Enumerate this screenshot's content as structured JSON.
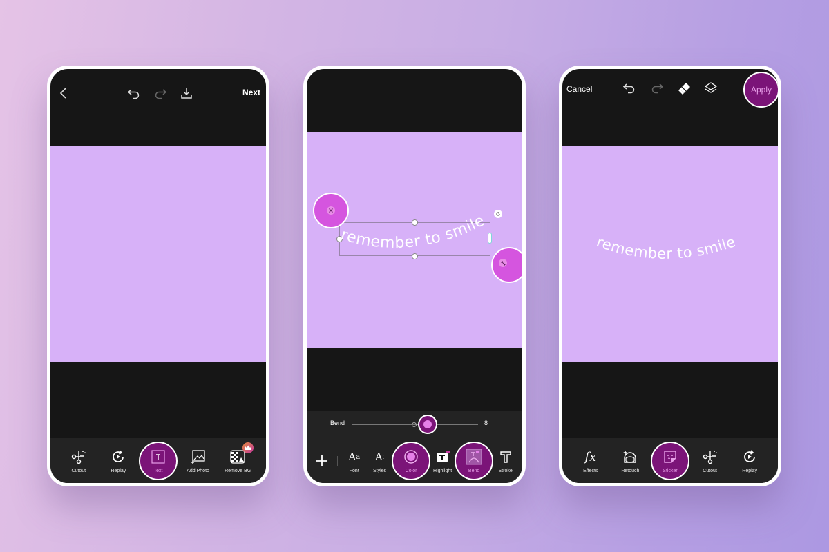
{
  "colors": {
    "canvas": "#d7b1f8",
    "screen": "#161616",
    "toolbar": "#232323",
    "accent": "#7b1478",
    "highlight": "#d555df",
    "accent_text": "#e79de8"
  },
  "phone1": {
    "topbar": {
      "back_icon": "chevron-left-icon",
      "undo_icon": "undo-icon",
      "redo_icon": "redo-icon",
      "download_icon": "download-icon",
      "next_label": "Next"
    },
    "toolbar": [
      {
        "label": "Cutout",
        "icon": "scissors-icon",
        "active": false
      },
      {
        "label": "Replay",
        "icon": "replay-icon",
        "active": false
      },
      {
        "label": "Text",
        "icon": "text-box-icon",
        "active": true
      },
      {
        "label": "Add Photo",
        "icon": "add-photo-icon",
        "active": false
      },
      {
        "label": "Remove BG",
        "icon": "remove-bg-icon",
        "active": false,
        "badge": "crown-icon"
      }
    ]
  },
  "phone2": {
    "text_layer": "remember to smile",
    "bend": {
      "label": "Bend",
      "value": "8"
    },
    "toolbar": [
      {
        "label": "",
        "icon": "plus-icon"
      },
      {
        "label": "Font",
        "icon": "font-icon",
        "active": false
      },
      {
        "label": "Styles",
        "icon": "styles-icon",
        "active": false
      },
      {
        "label": "Color",
        "icon": "color-icon",
        "active": true
      },
      {
        "label": "Highlight",
        "icon": "highlight-icon",
        "active": false
      },
      {
        "label": "Bend",
        "icon": "bend-icon",
        "active": true
      },
      {
        "label": "Stroke",
        "icon": "stroke-icon",
        "active": false
      }
    ]
  },
  "phone3": {
    "topbar": {
      "cancel_label": "Cancel",
      "undo_icon": "undo-icon",
      "redo_icon": "redo-icon",
      "eraser_icon": "eraser-icon",
      "layers_icon": "layers-icon",
      "apply_label": "Apply"
    },
    "text_layer": "remember to smile",
    "toolbar": [
      {
        "label": "Effects",
        "icon": "fx-icon",
        "active": false
      },
      {
        "label": "Retouch",
        "icon": "retouch-icon",
        "active": false
      },
      {
        "label": "Sticker",
        "icon": "sticker-icon",
        "active": true
      },
      {
        "label": "Cutout",
        "icon": "scissors-icon",
        "active": false
      },
      {
        "label": "Replay",
        "icon": "replay-icon",
        "active": false
      }
    ]
  }
}
